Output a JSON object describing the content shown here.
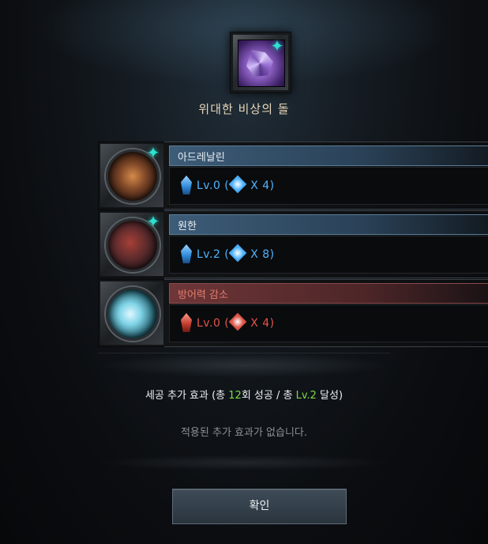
{
  "stone": {
    "title": "위대한 비상의 돌",
    "icon": "purple-crystal-stone-icon"
  },
  "abilities": [
    {
      "name": "아드레날린",
      "level_text": "Lv.0 (",
      "multiplier_text": "X 4)",
      "color": "#4fb4ff",
      "header_color": "#3d5c78",
      "icon": "adrenaline-orb-icon",
      "has_socket_star": true
    },
    {
      "name": "원한",
      "level_text": "Lv.2 (",
      "multiplier_text": "X 8)",
      "color": "#4fb4ff",
      "header_color": "#3d5c78",
      "icon": "grudge-orb-icon",
      "has_socket_star": true
    },
    {
      "name": "방어력 감소",
      "level_text": "Lv.0 (",
      "multiplier_text": "X 4)",
      "color": "#e0574a",
      "header_color": "#6e3638",
      "icon": "defense-reduction-orb-icon",
      "has_socket_star": false
    }
  ],
  "bonus": {
    "title_prefix": "세공 추가 효과 (총 ",
    "success_count": "12",
    "title_mid": "회 성공 / 총 ",
    "level": "Lv.2",
    "title_suffix": " 달성)",
    "empty_text": "적용된 추가 효과가 없습니다.",
    "highlight_color": "#7bd84b"
  },
  "confirm_button": {
    "label": "확인"
  }
}
